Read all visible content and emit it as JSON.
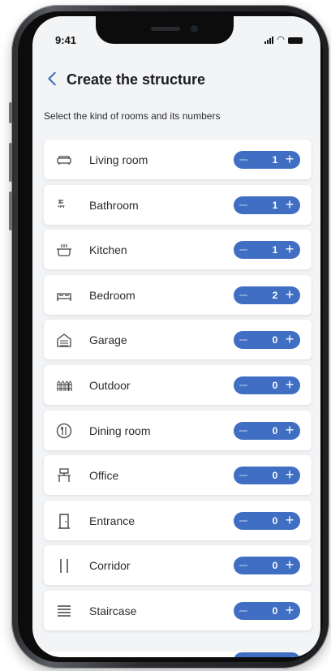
{
  "status_bar": {
    "time": "9:41"
  },
  "header": {
    "title": "Create the structure"
  },
  "subtitle": "Select the kind of rooms and its numbers",
  "colors": {
    "accent": "#3f6ec3",
    "back": "#3c68b8",
    "background": "#f3f4f6"
  },
  "rooms": [
    {
      "label": "Living room",
      "value": "1",
      "icon": "sofa-icon"
    },
    {
      "label": "Bathroom",
      "value": "1",
      "icon": "shower-icon"
    },
    {
      "label": "Kitchen",
      "value": "1",
      "icon": "pot-icon"
    },
    {
      "label": "Bedroom",
      "value": "2",
      "icon": "bed-icon"
    },
    {
      "label": "Garage",
      "value": "0",
      "icon": "garage-icon"
    },
    {
      "label": "Outdoor",
      "value": "0",
      "icon": "fence-icon"
    },
    {
      "label": "Dining room",
      "value": "0",
      "icon": "dining-icon"
    },
    {
      "label": "Office",
      "value": "0",
      "icon": "desk-icon"
    },
    {
      "label": "Entrance",
      "value": "0",
      "icon": "door-icon"
    },
    {
      "label": "Corridor",
      "value": "0",
      "icon": "corridor-icon"
    },
    {
      "label": "Staircase",
      "value": "0",
      "icon": "stairs-icon"
    }
  ]
}
